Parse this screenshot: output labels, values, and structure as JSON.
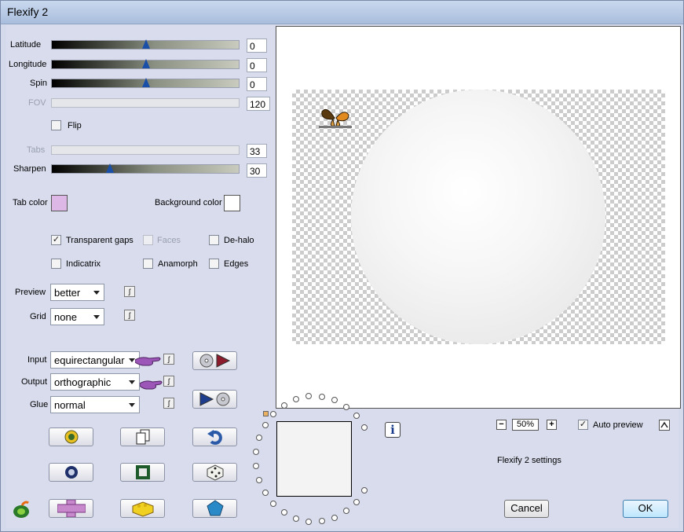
{
  "window": {
    "title": "Flexify 2"
  },
  "sliders": {
    "latitude": {
      "label": "Latitude",
      "value": "0",
      "level": 0.5
    },
    "longitude": {
      "label": "Longitude",
      "value": "0",
      "level": 0.5
    },
    "spin": {
      "label": "Spin",
      "value": "0",
      "level": 0.5
    },
    "fov": {
      "label": "FOV",
      "value": "120"
    },
    "tabs": {
      "label": "Tabs",
      "value": "33"
    },
    "sharpen": {
      "label": "Sharpen",
      "value": "30",
      "level": 0.3
    }
  },
  "flip": {
    "label": "Flip",
    "checked": false
  },
  "colors": {
    "tab_color_label": "Tab color",
    "tab_color": "#ddb8e6",
    "background_color_label": "Background color",
    "background_color": "#ffffff"
  },
  "options": {
    "transparent_gaps": "Transparent gaps",
    "faces": "Faces",
    "de_halo": "De-halo",
    "indicatrix": "Indicatrix",
    "anamorph": "Anamorph",
    "edges": "Edges",
    "check_mark": "✓"
  },
  "preview": {
    "label": "Preview",
    "value": "better"
  },
  "grid": {
    "label": "Grid",
    "value": "none"
  },
  "input": {
    "label": "Input",
    "value": "equirectangular"
  },
  "output": {
    "label": "Output",
    "value": "orthographic"
  },
  "glue": {
    "label": "Glue",
    "value": "normal"
  },
  "mini_button_glyph": "ʃ",
  "zoom": {
    "minus": "−",
    "value": "50%",
    "plus": "+"
  },
  "auto_preview": {
    "label": "Auto preview",
    "checked": true
  },
  "settings_name": "Flexify 2 settings",
  "info_glyph": "i",
  "buttons": {
    "cancel": "Cancel",
    "ok": "OK"
  },
  "accent": "#1a4fa8"
}
